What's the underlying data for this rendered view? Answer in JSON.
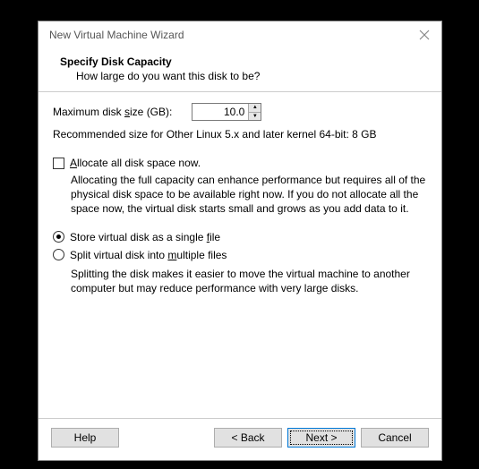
{
  "window": {
    "title": "New Virtual Machine Wizard"
  },
  "header": {
    "title": "Specify Disk Capacity",
    "subtitle": "How large do you want this disk to be?"
  },
  "disk": {
    "label_prefix": "Maximum disk ",
    "label_underline": "s",
    "label_suffix": "ize (GB):",
    "value": "10.0",
    "recommended": "Recommended size for Other Linux 5.x and later kernel 64-bit: 8 GB"
  },
  "allocate": {
    "label_underline": "A",
    "label_suffix": "llocate all disk space now.",
    "description": "Allocating the full capacity can enhance performance but requires all of the physical disk space to be available right now. If you do not allocate all the space now, the virtual disk starts small and grows as you add data to it.",
    "checked": false
  },
  "storage": {
    "single_prefix": "Store virtual disk as a single ",
    "single_underline": "f",
    "single_suffix": "ile",
    "split_prefix": "Split virtual disk into ",
    "split_underline": "m",
    "split_suffix": "ultiple files",
    "split_description": "Splitting the disk makes it easier to move the virtual machine to another computer but may reduce performance with very large disks.",
    "selected": "single"
  },
  "buttons": {
    "help": "Help",
    "back": "< Back",
    "next": "Next >",
    "cancel": "Cancel"
  }
}
